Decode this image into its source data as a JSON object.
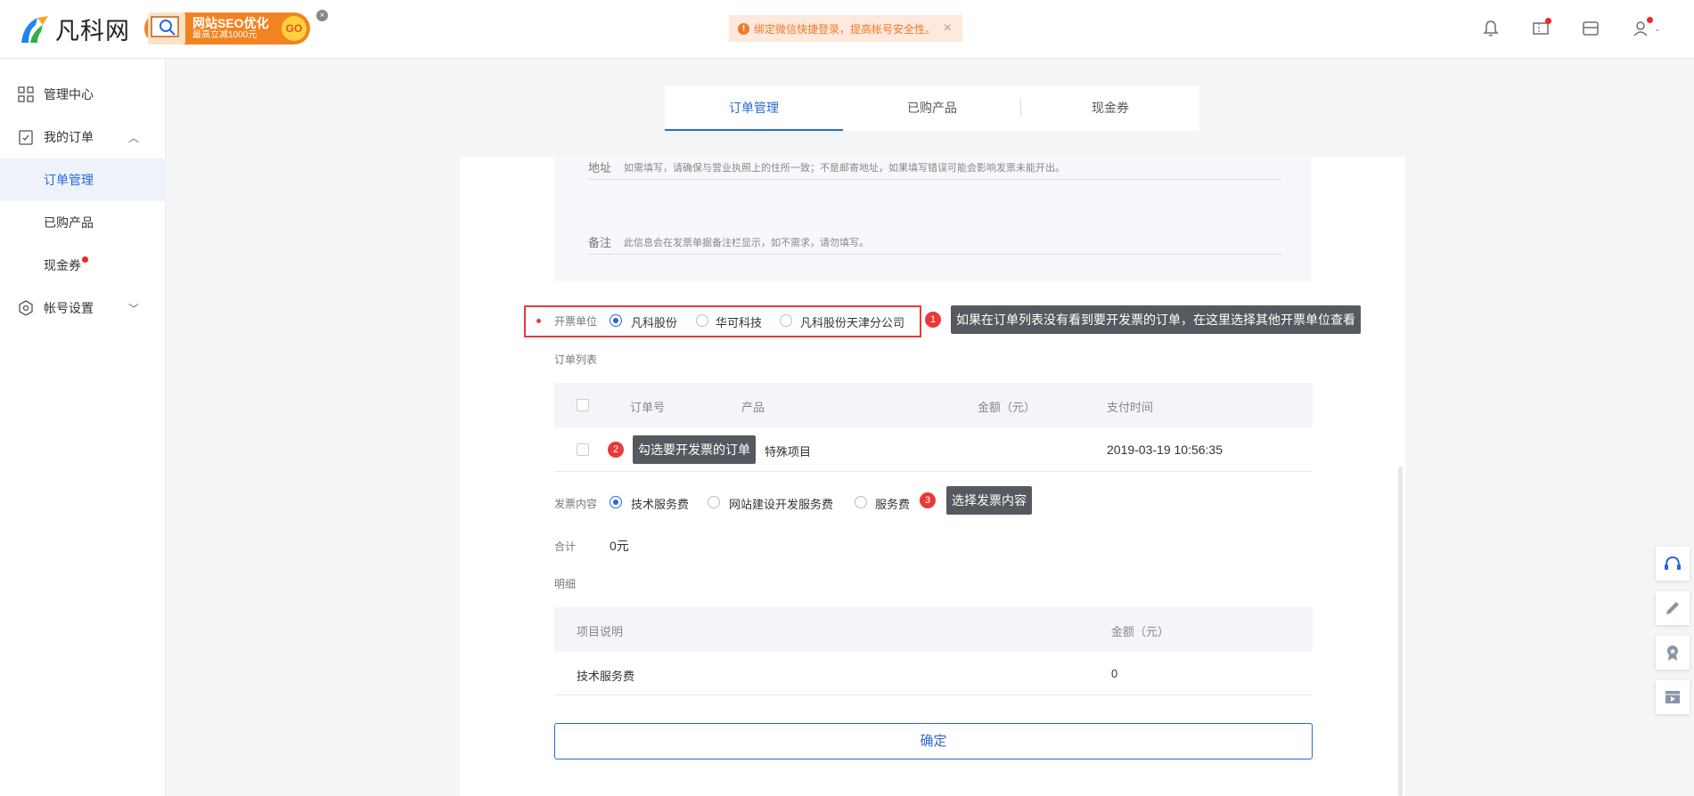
{
  "header": {
    "logo_text": "凡科网",
    "promo": {
      "title": "网站SEO优化",
      "subtitle": "最高立减1000元",
      "go": "GO",
      "close": "×"
    },
    "notice": {
      "icon": "!",
      "text": "绑定微信快捷登录，提高帐号安全性。",
      "close": "×"
    },
    "icons": [
      "bell-icon",
      "ticket-icon",
      "store-icon",
      "user-icon"
    ]
  },
  "sidebar": {
    "items": [
      {
        "label": "管理中心",
        "icon": "grid-icon"
      },
      {
        "label": "我的订单",
        "icon": "order-icon",
        "chevron": "^"
      },
      {
        "label": "订单管理"
      },
      {
        "label": "已购产品"
      },
      {
        "label": "现金券"
      },
      {
        "label": "帐号设置",
        "icon": "settings-icon",
        "chevron": "v"
      }
    ]
  },
  "tabs": [
    {
      "label": "订单管理"
    },
    {
      "label": "已购产品"
    },
    {
      "label": "现金券"
    }
  ],
  "form": {
    "address_label": "地址",
    "address_hint": "如需填写，请确保与营业执照上的住所一致；不是邮寄地址，如果填写错误可能会影响发票未能开出。",
    "remark_label": "备注",
    "remark_hint": "此信息会在发票单据备注栏显示，如不需求，请勿填写。",
    "issuer_label": "开票单位",
    "issuer_options": [
      "凡科股份",
      "华可科技",
      "凡科股份天津分公司"
    ],
    "order_list_label": "订单列表",
    "content_label": "发票内容",
    "content_options": [
      "技术服务费",
      "网站建设开发服务费",
      "服务费"
    ],
    "total_label": "合计",
    "total_value": "0元",
    "detail_label": "明细",
    "confirm": "确定"
  },
  "orders": {
    "columns": [
      "订单号",
      "产品",
      "金额（元）",
      "支付时间"
    ],
    "rows": [
      {
        "product": "特殊项目",
        "time": "2019-03-19 10:56:35"
      }
    ]
  },
  "details": {
    "columns": [
      "项目说明",
      "金额（元）"
    ],
    "rows": [
      {
        "item": "技术服务费",
        "amount": "0"
      }
    ]
  },
  "annotations": [
    {
      "num": "1",
      "text": "如果在订单列表没有看到要开发票的订单，在这里选择其他开票单位查看"
    },
    {
      "num": "2",
      "text": "勾选要开发票的订单"
    },
    {
      "num": "3",
      "text": "选择发票内容"
    }
  ],
  "float_tools": [
    "headset-icon",
    "pencil-icon",
    "badge-icon",
    "video-icon"
  ],
  "colors": {
    "accent": "#2a68d8",
    "alert": "#e8393b",
    "notice": "#f07a2a"
  }
}
